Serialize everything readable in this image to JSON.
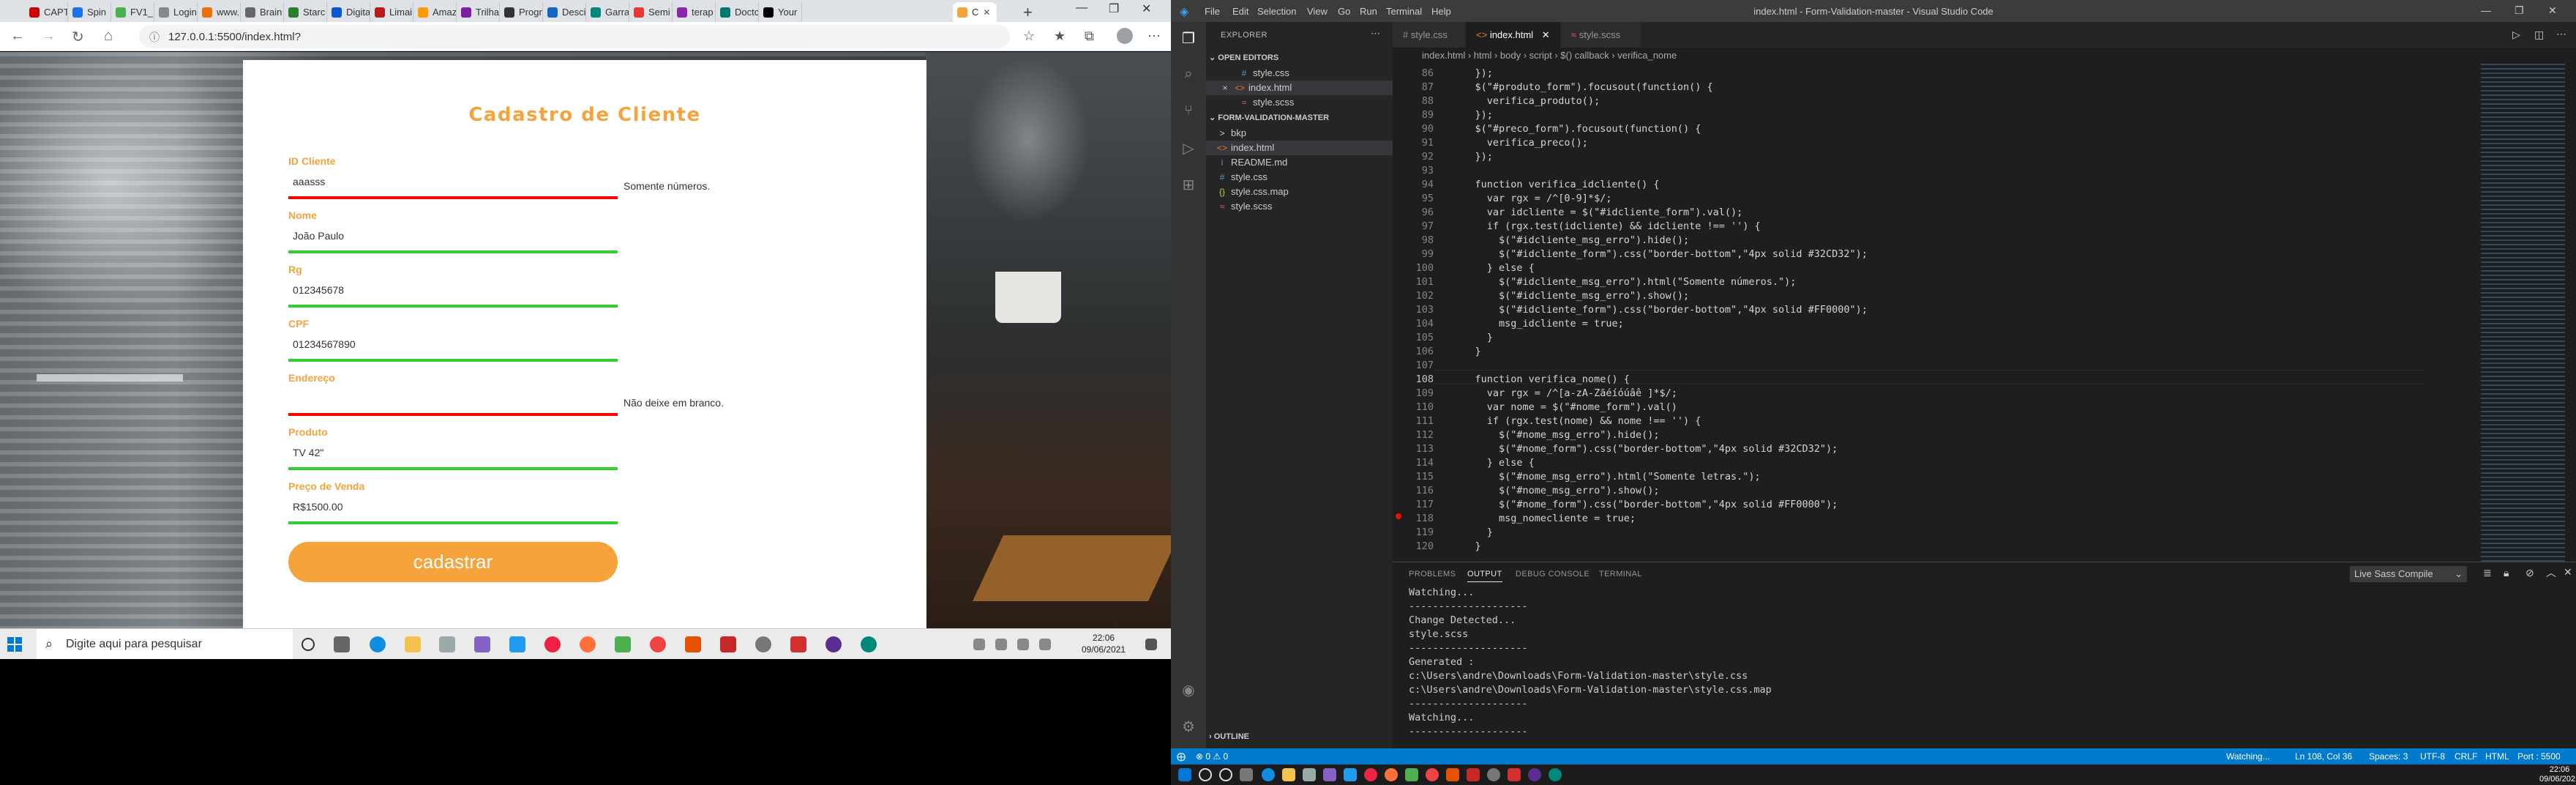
{
  "browser": {
    "tabs": [
      {
        "label": "CAPT",
        "color": "#cc0000"
      },
      {
        "label": "Spin",
        "color": "#1a73e8"
      },
      {
        "label": "FV1_",
        "color": "#4caf50"
      },
      {
        "label": "Login",
        "color": "#888888"
      },
      {
        "label": "www.",
        "color": "#e8710a"
      },
      {
        "label": "Brain",
        "color": "#666666"
      },
      {
        "label": "Starc",
        "color": "#2e7d32"
      },
      {
        "label": "Digita",
        "color": "#0b57d0"
      },
      {
        "label": "Limai",
        "color": "#b71c1c"
      },
      {
        "label": "Amaz",
        "color": "#ff9900"
      },
      {
        "label": "Trilha",
        "color": "#7b1fa2"
      },
      {
        "label": "Progr",
        "color": "#333333"
      },
      {
        "label": "Desci",
        "color": "#1565c0"
      },
      {
        "label": "Garra",
        "color": "#00897b"
      },
      {
        "label": "Semi",
        "color": "#e53935"
      },
      {
        "label": "terap",
        "color": "#8e24aa"
      },
      {
        "label": "Doctc",
        "color": "#00796b"
      },
      {
        "label": "Your",
        "color": "#000000"
      }
    ],
    "active_tab": "C",
    "new_tab": "+",
    "url": "127.0.0.1:5500/index.html?"
  },
  "form": {
    "title": "Cadastro de Cliente",
    "fields": [
      {
        "label": "ID Cliente",
        "value": "aaasss",
        "error": true,
        "message": "Somente números."
      },
      {
        "label": "Nome",
        "value": "João Paulo",
        "error": false,
        "message": ""
      },
      {
        "label": "Rg",
        "value": "012345678",
        "error": false,
        "message": ""
      },
      {
        "label": "CPF",
        "value": "01234567890",
        "error": false,
        "message": ""
      },
      {
        "label": "Endereço",
        "value": "",
        "error": true,
        "message": "Não deixe em branco."
      },
      {
        "label": "Produto",
        "value": "TV 42\"",
        "error": false,
        "message": ""
      },
      {
        "label": "Preço de Venda",
        "value": "R$1500.00",
        "error": false,
        "message": ""
      }
    ],
    "submit_label": "cadastrar",
    "colors": {
      "accent": "#f5a33a",
      "ok": "#32CD32",
      "error": "#FF0000"
    }
  },
  "taskbar_left": {
    "search_placeholder": "Digite aqui para pesquisar",
    "time": "22:06",
    "date": "09/06/2021"
  },
  "vscode": {
    "menu": [
      "File",
      "Edit",
      "Selection",
      "View",
      "Go",
      "Run",
      "Terminal",
      "Help"
    ],
    "window_title": "index.html - Form-Validation-master - Visual Studio Code",
    "explorer": {
      "header": "EXPLORER",
      "open_editors_title": "OPEN EDITORS",
      "open_editors": [
        {
          "name": "style.css",
          "icon": "#"
        },
        {
          "name": "index.html",
          "icon": "<>"
        },
        {
          "name": "style.scss",
          "icon": "≈"
        }
      ],
      "close_mark": "×",
      "project_title": "FORM-VALIDATION-MASTER",
      "files": [
        {
          "name": "bkp",
          "icon": ">"
        },
        {
          "name": "index.html",
          "icon": "<>"
        },
        {
          "name": "README.md",
          "icon": "i"
        },
        {
          "name": "style.css",
          "icon": "#"
        },
        {
          "name": "style.css.map",
          "icon": "{}"
        },
        {
          "name": "style.scss",
          "icon": "≈"
        }
      ],
      "outline": "OUTLINE"
    },
    "tabs": [
      {
        "name": "style.css",
        "icon": "#",
        "active": false
      },
      {
        "name": "index.html",
        "icon": "<>",
        "active": true
      },
      {
        "name": "style.scss",
        "icon": "≈",
        "active": false
      }
    ],
    "breadcrumb": "index.html › html › body › script › $() callback › verifica_nome",
    "code_lines": [
      {
        "n": "86",
        "t": "    });"
      },
      {
        "n": "87",
        "t": "    $(\"#produto_form\").focusout(function() {"
      },
      {
        "n": "88",
        "t": "      verifica_produto();"
      },
      {
        "n": "89",
        "t": "    });"
      },
      {
        "n": "90",
        "t": "    $(\"#preco_form\").focusout(function() {"
      },
      {
        "n": "91",
        "t": "      verifica_preco();"
      },
      {
        "n": "92",
        "t": "    });"
      },
      {
        "n": "93",
        "t": ""
      },
      {
        "n": "94",
        "t": "    function verifica_idcliente() {"
      },
      {
        "n": "95",
        "t": "      var rgx = /^[0-9]*$/;"
      },
      {
        "n": "96",
        "t": "      var idcliente = $(\"#idcliente_form\").val();"
      },
      {
        "n": "97",
        "t": "      if (rgx.test(idcliente) && idcliente !== '') {"
      },
      {
        "n": "98",
        "t": "        $(\"#idcliente_msg_erro\").hide();"
      },
      {
        "n": "99",
        "t": "        $(\"#idcliente_form\").css(\"border-bottom\",\"4px solid #32CD32\");"
      },
      {
        "n": "100",
        "t": "      } else {"
      },
      {
        "n": "101",
        "t": "        $(\"#idcliente_msg_erro\").html(\"Somente números.\");"
      },
      {
        "n": "102",
        "t": "        $(\"#idcliente_msg_erro\").show();"
      },
      {
        "n": "103",
        "t": "        $(\"#idcliente_form\").css(\"border-bottom\",\"4px solid #FF0000\");"
      },
      {
        "n": "104",
        "t": "        msg_idcliente = true;"
      },
      {
        "n": "105",
        "t": "      }"
      },
      {
        "n": "106",
        "t": "    }"
      },
      {
        "n": "107",
        "t": ""
      },
      {
        "n": "108",
        "t": "    function verifica_nome() {"
      },
      {
        "n": "109",
        "t": "      var rgx = /^[a-zA-Zãéíóúâê ]*$/;"
      },
      {
        "n": "110",
        "t": "      var nome = $(\"#nome_form\").val()"
      },
      {
        "n": "111",
        "t": "      if (rgx.test(nome) && nome !== '') {"
      },
      {
        "n": "112",
        "t": "        $(\"#nome_msg_erro\").hide();"
      },
      {
        "n": "113",
        "t": "        $(\"#nome_form\").css(\"border-bottom\",\"4px solid #32CD32\");"
      },
      {
        "n": "114",
        "t": "      } else {"
      },
      {
        "n": "115",
        "t": "        $(\"#nome_msg_erro\").html(\"Somente letras.\");"
      },
      {
        "n": "116",
        "t": "        $(\"#nome_msg_erro\").show();"
      },
      {
        "n": "117",
        "t": "        $(\"#nome_form\").css(\"border-bottom\",\"4px solid #FF0000\");"
      },
      {
        "n": "118",
        "t": "        msg_nomecliente = true;"
      },
      {
        "n": "119",
        "t": "      }"
      },
      {
        "n": "120",
        "t": "    }"
      }
    ],
    "current_line": "108",
    "panel": {
      "tabs": [
        "PROBLEMS",
        "OUTPUT",
        "DEBUG CONSOLE",
        "TERMINAL"
      ],
      "active": "OUTPUT",
      "select": "Live Sass Compile",
      "output": "Watching...\n--------------------\nChange Detected...\nstyle.scss\n--------------------\nGenerated :\nc:\\Users\\andre\\Downloads\\Form-Validation-master\\style.css\nc:\\Users\\andre\\Downloads\\Form-Validation-master\\style.css.map\n--------------------\nWatching...\n--------------------"
    },
    "status": {
      "left_errors": "⊗ 0 ⚠ 0",
      "watching": "Watching...",
      "position": "Ln 108, Col 36",
      "spaces": "Spaces: 3",
      "encoding": "UTF-8",
      "eol": "CRLF",
      "language": "HTML",
      "port": "Port : 5500"
    },
    "taskbar_time": "22:06",
    "taskbar_date": "09/06/2021"
  }
}
